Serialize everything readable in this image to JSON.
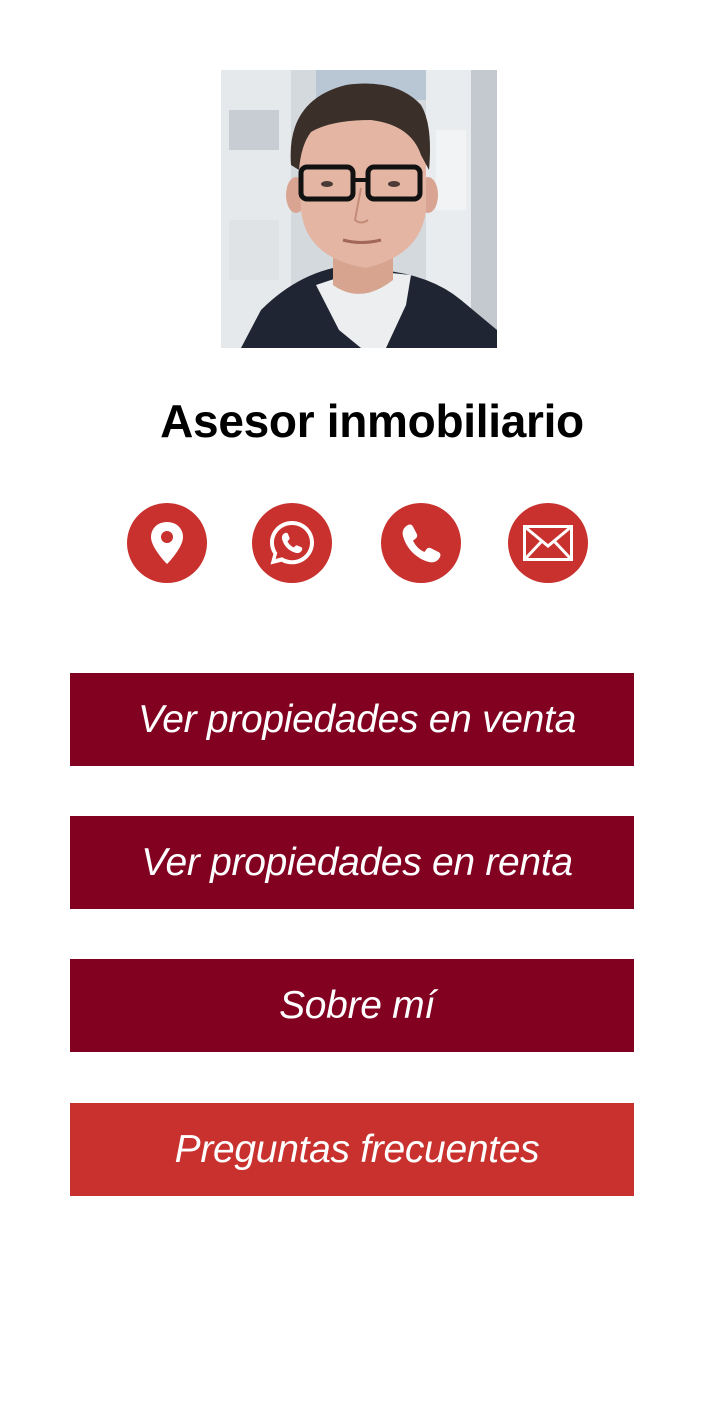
{
  "profile": {
    "title": "Asesor inmobiliario"
  },
  "contact_icons": [
    {
      "name": "location-pin-icon"
    },
    {
      "name": "whatsapp-icon"
    },
    {
      "name": "phone-icon"
    },
    {
      "name": "email-icon"
    }
  ],
  "menu": {
    "sale_label": "Ver propiedades en venta",
    "rent_label": "Ver propiedades en renta",
    "about_label": "Sobre mí",
    "faq_label": "Preguntas frecuentes"
  },
  "colors": {
    "icon_red": "#c8312d",
    "button_dark_red": "#820020",
    "button_accent_red": "#c8312d"
  }
}
